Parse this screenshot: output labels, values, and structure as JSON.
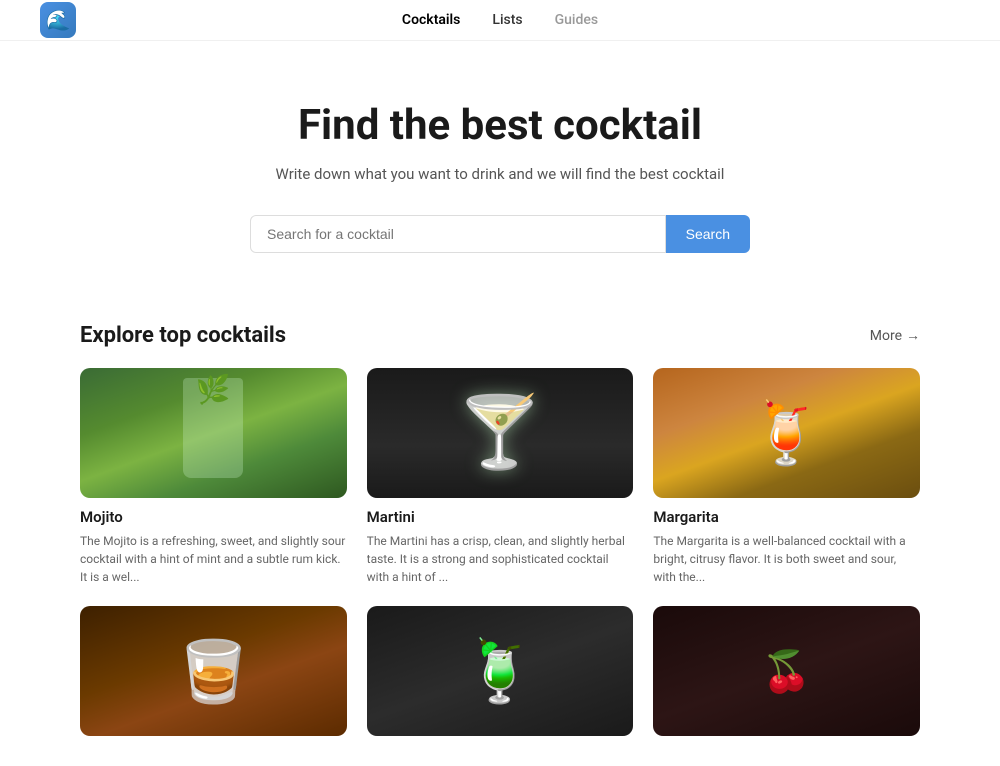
{
  "nav": {
    "logo_emoji": "🌊",
    "items": [
      {
        "label": "Cocktails",
        "id": "cocktails",
        "active": true
      },
      {
        "label": "Lists",
        "id": "lists",
        "active": false
      },
      {
        "label": "Guides",
        "id": "guides",
        "active": false,
        "muted": true
      }
    ]
  },
  "hero": {
    "title": "Find the best cocktail",
    "subtitle": "Write down what you want to drink and we will find the best cocktail"
  },
  "search": {
    "placeholder": "Search for a cocktail",
    "button_label": "Search"
  },
  "explore": {
    "title": "Explore top cocktails",
    "more_label": "More",
    "more_arrow": "→",
    "cocktails": [
      {
        "name": "Mojito",
        "description": "The Mojito is a refreshing, sweet, and slightly sour cocktail with a hint of mint and a subtle rum kick. It is a wel...",
        "image_class": "img-mojito"
      },
      {
        "name": "Martini",
        "description": "The Martini has a crisp, clean, and slightly herbal taste. It is a strong and sophisticated cocktail with a hint of ...",
        "image_class": "img-martini"
      },
      {
        "name": "Margarita",
        "description": "The Margarita is a well-balanced cocktail with a bright, citrusy flavor. It is both sweet and sour, with the...",
        "image_class": "img-margarita"
      },
      {
        "name": "",
        "description": "",
        "image_class": "img-whiskey"
      },
      {
        "name": "",
        "description": "",
        "image_class": "img-daiquiri"
      },
      {
        "name": "",
        "description": "",
        "image_class": "img-last"
      }
    ]
  }
}
